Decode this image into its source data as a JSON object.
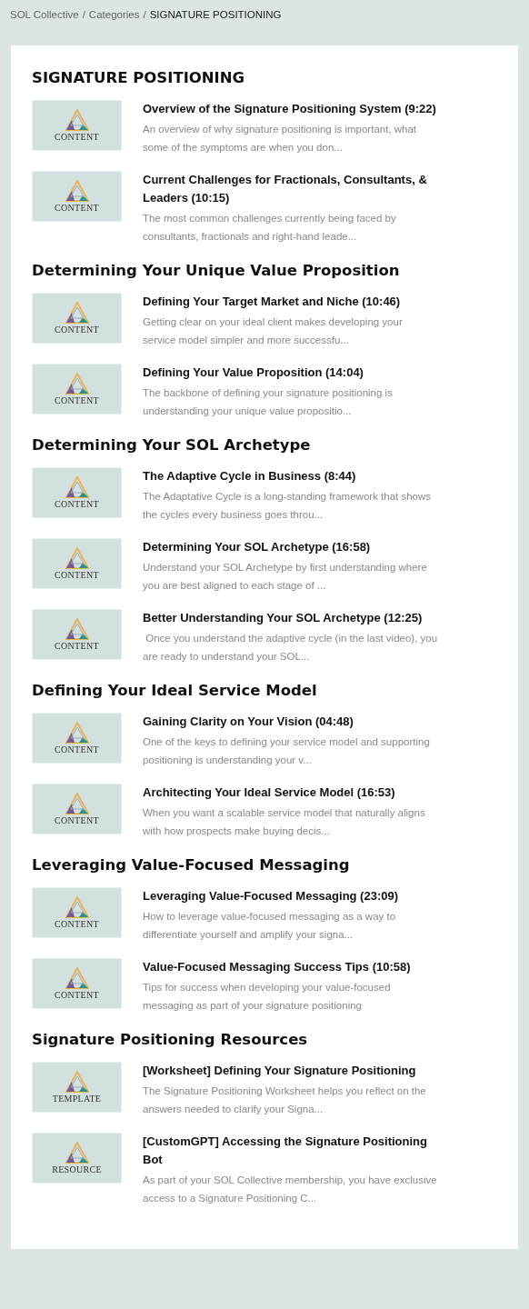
{
  "breadcrumb_separator": "/",
  "breadcrumb": [
    {
      "label": "SOL Collective",
      "current": false
    },
    {
      "label": "Categories",
      "current": false
    },
    {
      "label": "SIGNATURE POSITIONING",
      "current": true
    }
  ],
  "sections": [
    {
      "heading": "SIGNATURE POSITIONING",
      "items": [
        {
          "thumb_label": "CONTENT",
          "title": "Overview of the Signature Positioning System (9:22)",
          "description": "An overview of why signature positioning is important, what some of the symptoms are when you don..."
        },
        {
          "thumb_label": "CONTENT",
          "title": "Current Challenges for Fractionals, Consultants, & Leaders (10:15)",
          "description": "The most common challenges currently being faced by consultants, fractionals and right-hand leade..."
        }
      ]
    },
    {
      "heading": "Determining Your Unique Value Proposition",
      "items": [
        {
          "thumb_label": "CONTENT",
          "title": "Defining Your Target Market and Niche (10:46)",
          "description": "Getting clear on your ideal client makes developing your service model simpler and more successfu..."
        },
        {
          "thumb_label": "CONTENT",
          "title": "Defining Your Value Proposition (14:04)",
          "description": "The backbone of defining your signature positioning is understanding your unique value propositio..."
        }
      ]
    },
    {
      "heading": "Determining Your SOL Archetype",
      "items": [
        {
          "thumb_label": "CONTENT",
          "title": "The Adaptive Cycle in Business (8:44)",
          "description": "The Adaptative Cycle is a long-standing framework that shows the cycles every business goes throu..."
        },
        {
          "thumb_label": "CONTENT",
          "title": "Determining Your SOL Archetype (16:58)",
          "description": "Understand your SOL Archetype by first understanding where you are best aligned to each stage of ..."
        },
        {
          "thumb_label": "CONTENT",
          "title": "Better Understanding Your SOL Archetype (12:25)",
          "description": " Once you understand the adaptive cycle (in the last video), you are ready to understand your SOL..."
        }
      ]
    },
    {
      "heading": "Defining Your Ideal Service Model",
      "items": [
        {
          "thumb_label": "CONTENT",
          "title": "Gaining Clarity on Your Vision (04:48)",
          "description": "One of the keys to defining your service model and supporting positioning is understanding your v..."
        },
        {
          "thumb_label": "CONTENT",
          "title": "Architecting Your Ideal Service Model (16:53)",
          "description": "When you want a scalable service model that naturally aligns with how prospects make buying decis..."
        }
      ]
    },
    {
      "heading": "Leveraging Value-Focused Messaging",
      "items": [
        {
          "thumb_label": "CONTENT",
          "title": "Leveraging Value-Focused Messaging (23:09)",
          "description": "How to leverage value-focused messaging as a way to differentiate yourself and amplify your signa..."
        },
        {
          "thumb_label": "CONTENT",
          "title": "Value-Focused Messaging Success Tips (10:58)",
          "description": "Tips for success when developing your value-focused messaging as part of your signature positioning"
        }
      ]
    },
    {
      "heading": "Signature Positioning Resources",
      "items": [
        {
          "thumb_label": "TEMPLATE",
          "title": "[Worksheet] Defining Your Signature Positioning",
          "description": "The Signature Positioning Worksheet helps you reflect on the answers needed to clarify your Signa..."
        },
        {
          "thumb_label": "RESOURCE",
          "title": "[CustomGPT] Accessing the Signature Positioning Bot",
          "description": "As part of your SOL Collective membership, you have exclusive access to a Signature Positioning C..."
        }
      ]
    }
  ]
}
